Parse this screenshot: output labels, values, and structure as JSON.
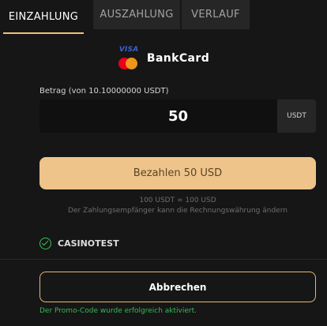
{
  "tabs": [
    {
      "label": "EINZAHLUNG",
      "active": true
    },
    {
      "label": "AUSZAHLUNG",
      "active": false
    },
    {
      "label": "VERLAUF",
      "active": false
    }
  ],
  "payment_method": {
    "logo_text": "VISA",
    "logo_icons": [
      "visa-icon",
      "mastercard-icon"
    ],
    "name": "BankCard"
  },
  "amount": {
    "label": "Betrag (von 10.10000000 USDT)",
    "value": "50",
    "currency": "USDT"
  },
  "pay_button_label": "Bezahlen 50 USD",
  "rate_text": "100 USDT = 100 USD",
  "note_text": "Der Zahlungsempfänger kann die Rechnungswährung ändern",
  "promo": {
    "code": "CASINOTEST",
    "success_message": "Der Promo-Code wurde erfolgreich aktiviert."
  },
  "cancel_button_label": "Abbrechen",
  "colors": {
    "background": "#161616",
    "accent": "#eec48b",
    "success": "#38c15a",
    "tab_inactive": "#262626"
  }
}
